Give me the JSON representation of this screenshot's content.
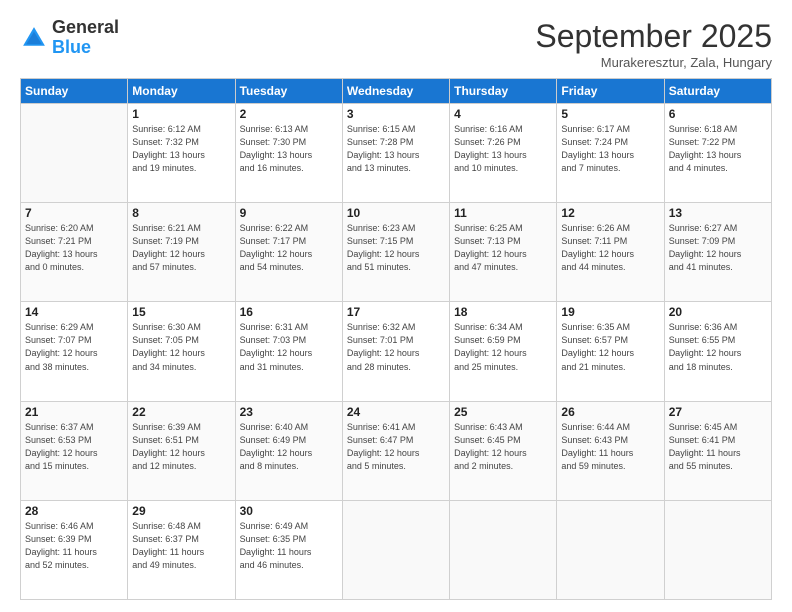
{
  "header": {
    "logo_line1": "General",
    "logo_line2": "Blue",
    "month": "September 2025",
    "location": "Murakeresztur, Zala, Hungary"
  },
  "weekdays": [
    "Sunday",
    "Monday",
    "Tuesday",
    "Wednesday",
    "Thursday",
    "Friday",
    "Saturday"
  ],
  "weeks": [
    [
      {
        "day": "",
        "info": ""
      },
      {
        "day": "1",
        "info": "Sunrise: 6:12 AM\nSunset: 7:32 PM\nDaylight: 13 hours\nand 19 minutes."
      },
      {
        "day": "2",
        "info": "Sunrise: 6:13 AM\nSunset: 7:30 PM\nDaylight: 13 hours\nand 16 minutes."
      },
      {
        "day": "3",
        "info": "Sunrise: 6:15 AM\nSunset: 7:28 PM\nDaylight: 13 hours\nand 13 minutes."
      },
      {
        "day": "4",
        "info": "Sunrise: 6:16 AM\nSunset: 7:26 PM\nDaylight: 13 hours\nand 10 minutes."
      },
      {
        "day": "5",
        "info": "Sunrise: 6:17 AM\nSunset: 7:24 PM\nDaylight: 13 hours\nand 7 minutes."
      },
      {
        "day": "6",
        "info": "Sunrise: 6:18 AM\nSunset: 7:22 PM\nDaylight: 13 hours\nand 4 minutes."
      }
    ],
    [
      {
        "day": "7",
        "info": "Sunrise: 6:20 AM\nSunset: 7:21 PM\nDaylight: 13 hours\nand 0 minutes."
      },
      {
        "day": "8",
        "info": "Sunrise: 6:21 AM\nSunset: 7:19 PM\nDaylight: 12 hours\nand 57 minutes."
      },
      {
        "day": "9",
        "info": "Sunrise: 6:22 AM\nSunset: 7:17 PM\nDaylight: 12 hours\nand 54 minutes."
      },
      {
        "day": "10",
        "info": "Sunrise: 6:23 AM\nSunset: 7:15 PM\nDaylight: 12 hours\nand 51 minutes."
      },
      {
        "day": "11",
        "info": "Sunrise: 6:25 AM\nSunset: 7:13 PM\nDaylight: 12 hours\nand 47 minutes."
      },
      {
        "day": "12",
        "info": "Sunrise: 6:26 AM\nSunset: 7:11 PM\nDaylight: 12 hours\nand 44 minutes."
      },
      {
        "day": "13",
        "info": "Sunrise: 6:27 AM\nSunset: 7:09 PM\nDaylight: 12 hours\nand 41 minutes."
      }
    ],
    [
      {
        "day": "14",
        "info": "Sunrise: 6:29 AM\nSunset: 7:07 PM\nDaylight: 12 hours\nand 38 minutes."
      },
      {
        "day": "15",
        "info": "Sunrise: 6:30 AM\nSunset: 7:05 PM\nDaylight: 12 hours\nand 34 minutes."
      },
      {
        "day": "16",
        "info": "Sunrise: 6:31 AM\nSunset: 7:03 PM\nDaylight: 12 hours\nand 31 minutes."
      },
      {
        "day": "17",
        "info": "Sunrise: 6:32 AM\nSunset: 7:01 PM\nDaylight: 12 hours\nand 28 minutes."
      },
      {
        "day": "18",
        "info": "Sunrise: 6:34 AM\nSunset: 6:59 PM\nDaylight: 12 hours\nand 25 minutes."
      },
      {
        "day": "19",
        "info": "Sunrise: 6:35 AM\nSunset: 6:57 PM\nDaylight: 12 hours\nand 21 minutes."
      },
      {
        "day": "20",
        "info": "Sunrise: 6:36 AM\nSunset: 6:55 PM\nDaylight: 12 hours\nand 18 minutes."
      }
    ],
    [
      {
        "day": "21",
        "info": "Sunrise: 6:37 AM\nSunset: 6:53 PM\nDaylight: 12 hours\nand 15 minutes."
      },
      {
        "day": "22",
        "info": "Sunrise: 6:39 AM\nSunset: 6:51 PM\nDaylight: 12 hours\nand 12 minutes."
      },
      {
        "day": "23",
        "info": "Sunrise: 6:40 AM\nSunset: 6:49 PM\nDaylight: 12 hours\nand 8 minutes."
      },
      {
        "day": "24",
        "info": "Sunrise: 6:41 AM\nSunset: 6:47 PM\nDaylight: 12 hours\nand 5 minutes."
      },
      {
        "day": "25",
        "info": "Sunrise: 6:43 AM\nSunset: 6:45 PM\nDaylight: 12 hours\nand 2 minutes."
      },
      {
        "day": "26",
        "info": "Sunrise: 6:44 AM\nSunset: 6:43 PM\nDaylight: 11 hours\nand 59 minutes."
      },
      {
        "day": "27",
        "info": "Sunrise: 6:45 AM\nSunset: 6:41 PM\nDaylight: 11 hours\nand 55 minutes."
      }
    ],
    [
      {
        "day": "28",
        "info": "Sunrise: 6:46 AM\nSunset: 6:39 PM\nDaylight: 11 hours\nand 52 minutes."
      },
      {
        "day": "29",
        "info": "Sunrise: 6:48 AM\nSunset: 6:37 PM\nDaylight: 11 hours\nand 49 minutes."
      },
      {
        "day": "30",
        "info": "Sunrise: 6:49 AM\nSunset: 6:35 PM\nDaylight: 11 hours\nand 46 minutes."
      },
      {
        "day": "",
        "info": ""
      },
      {
        "day": "",
        "info": ""
      },
      {
        "day": "",
        "info": ""
      },
      {
        "day": "",
        "info": ""
      }
    ]
  ]
}
